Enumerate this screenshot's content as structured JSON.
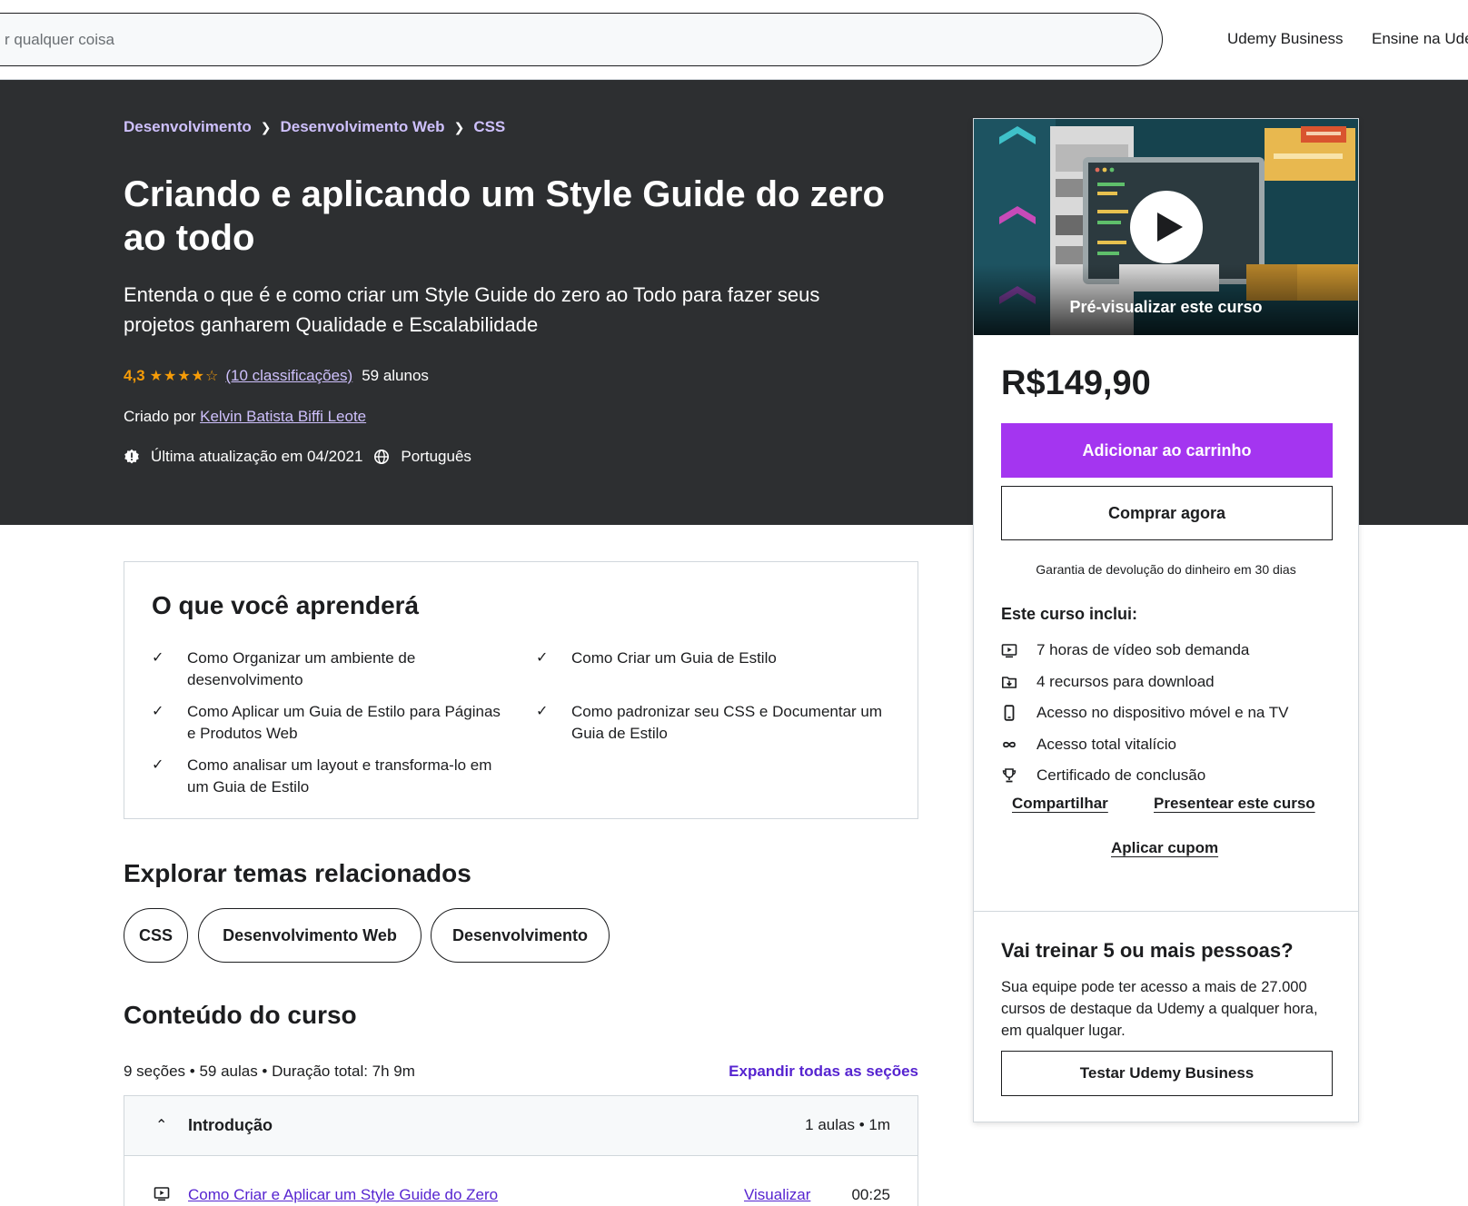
{
  "header": {
    "search_placeholder": "r qualquer coisa",
    "nav": [
      "Udemy Business",
      "Ensine na Ude"
    ]
  },
  "breadcrumb": [
    "Desenvolvimento",
    "Desenvolvimento Web",
    "CSS"
  ],
  "course": {
    "title": "Criando e aplicando um Style Guide do zero ao todo",
    "subtitle": "Entenda o que é e como criar um Style Guide do zero ao Todo para fazer seus projetos ganharem Qualidade e Escalabilidade",
    "rating": "4,3",
    "stars": 4.3,
    "ratings_count": "(10 classificações)",
    "students": "59 alunos",
    "created_by_label": "Criado por",
    "instructor": "Kelvin Batista Biffi Leote",
    "last_updated": "Última atualização em 04/2021",
    "language": "Português"
  },
  "card": {
    "preview_label": "Pré-visualizar este curso",
    "price": "R$149,90",
    "add_to_cart": "Adicionar ao carrinho",
    "buy_now": "Comprar agora",
    "guarantee": "Garantia de devolução do dinheiro em 30 dias",
    "includes_title": "Este curso inclui:",
    "includes": [
      {
        "icon": "video-icon",
        "label": "7 horas de vídeo sob demanda"
      },
      {
        "icon": "download-icon",
        "label": "4 recursos para download"
      },
      {
        "icon": "mobile-icon",
        "label": "Acesso no dispositivo móvel e na TV"
      },
      {
        "icon": "infinity-icon",
        "label": "Acesso total vitalício"
      },
      {
        "icon": "trophy-icon",
        "label": "Certificado de conclusão"
      }
    ],
    "share": "Compartilhar",
    "gift": "Presentear este curso",
    "coupon": "Aplicar cupom",
    "business_title": "Vai treinar 5 ou mais pessoas?",
    "business_text": "Sua equipe pode ter acesso a mais de 27.000 cursos de destaque da Udemy a qualquer hora, em qualquer lugar.",
    "business_button": "Testar Udemy Business"
  },
  "learn": {
    "title": "O que você aprenderá",
    "items": [
      "Como Organizar um ambiente de desenvolvimento",
      "Como Criar um Guia de Estilo",
      "Como Aplicar um Guia de Estilo para Páginas e Produtos Web",
      "Como padronizar seu CSS e Documentar um Guia de Estilo",
      "Como analisar um layout e transforma-lo em um Guia de Estilo"
    ]
  },
  "related": {
    "title": "Explorar temas relacionados",
    "topics": [
      "CSS",
      "Desenvolvimento Web",
      "Desenvolvimento"
    ]
  },
  "content": {
    "title": "Conteúdo do curso",
    "summary": "9 seções • 59 aulas • Duração total: 7h 9m",
    "expand_all": "Expandir todas as seções",
    "sections": [
      {
        "title": "Introdução",
        "meta": "1 aulas • 1m",
        "lectures": [
          {
            "title": "Como Criar e Aplicar um Style Guide do Zero",
            "preview": "Visualizar",
            "duration": "00:25"
          }
        ]
      }
    ]
  },
  "colors": {
    "hero_bg": "#2d2f31",
    "accent_purple": "#a435f0",
    "link_purple": "#5624d0",
    "light_purple": "#cec0fc",
    "rating_orange": "#f69c08"
  }
}
